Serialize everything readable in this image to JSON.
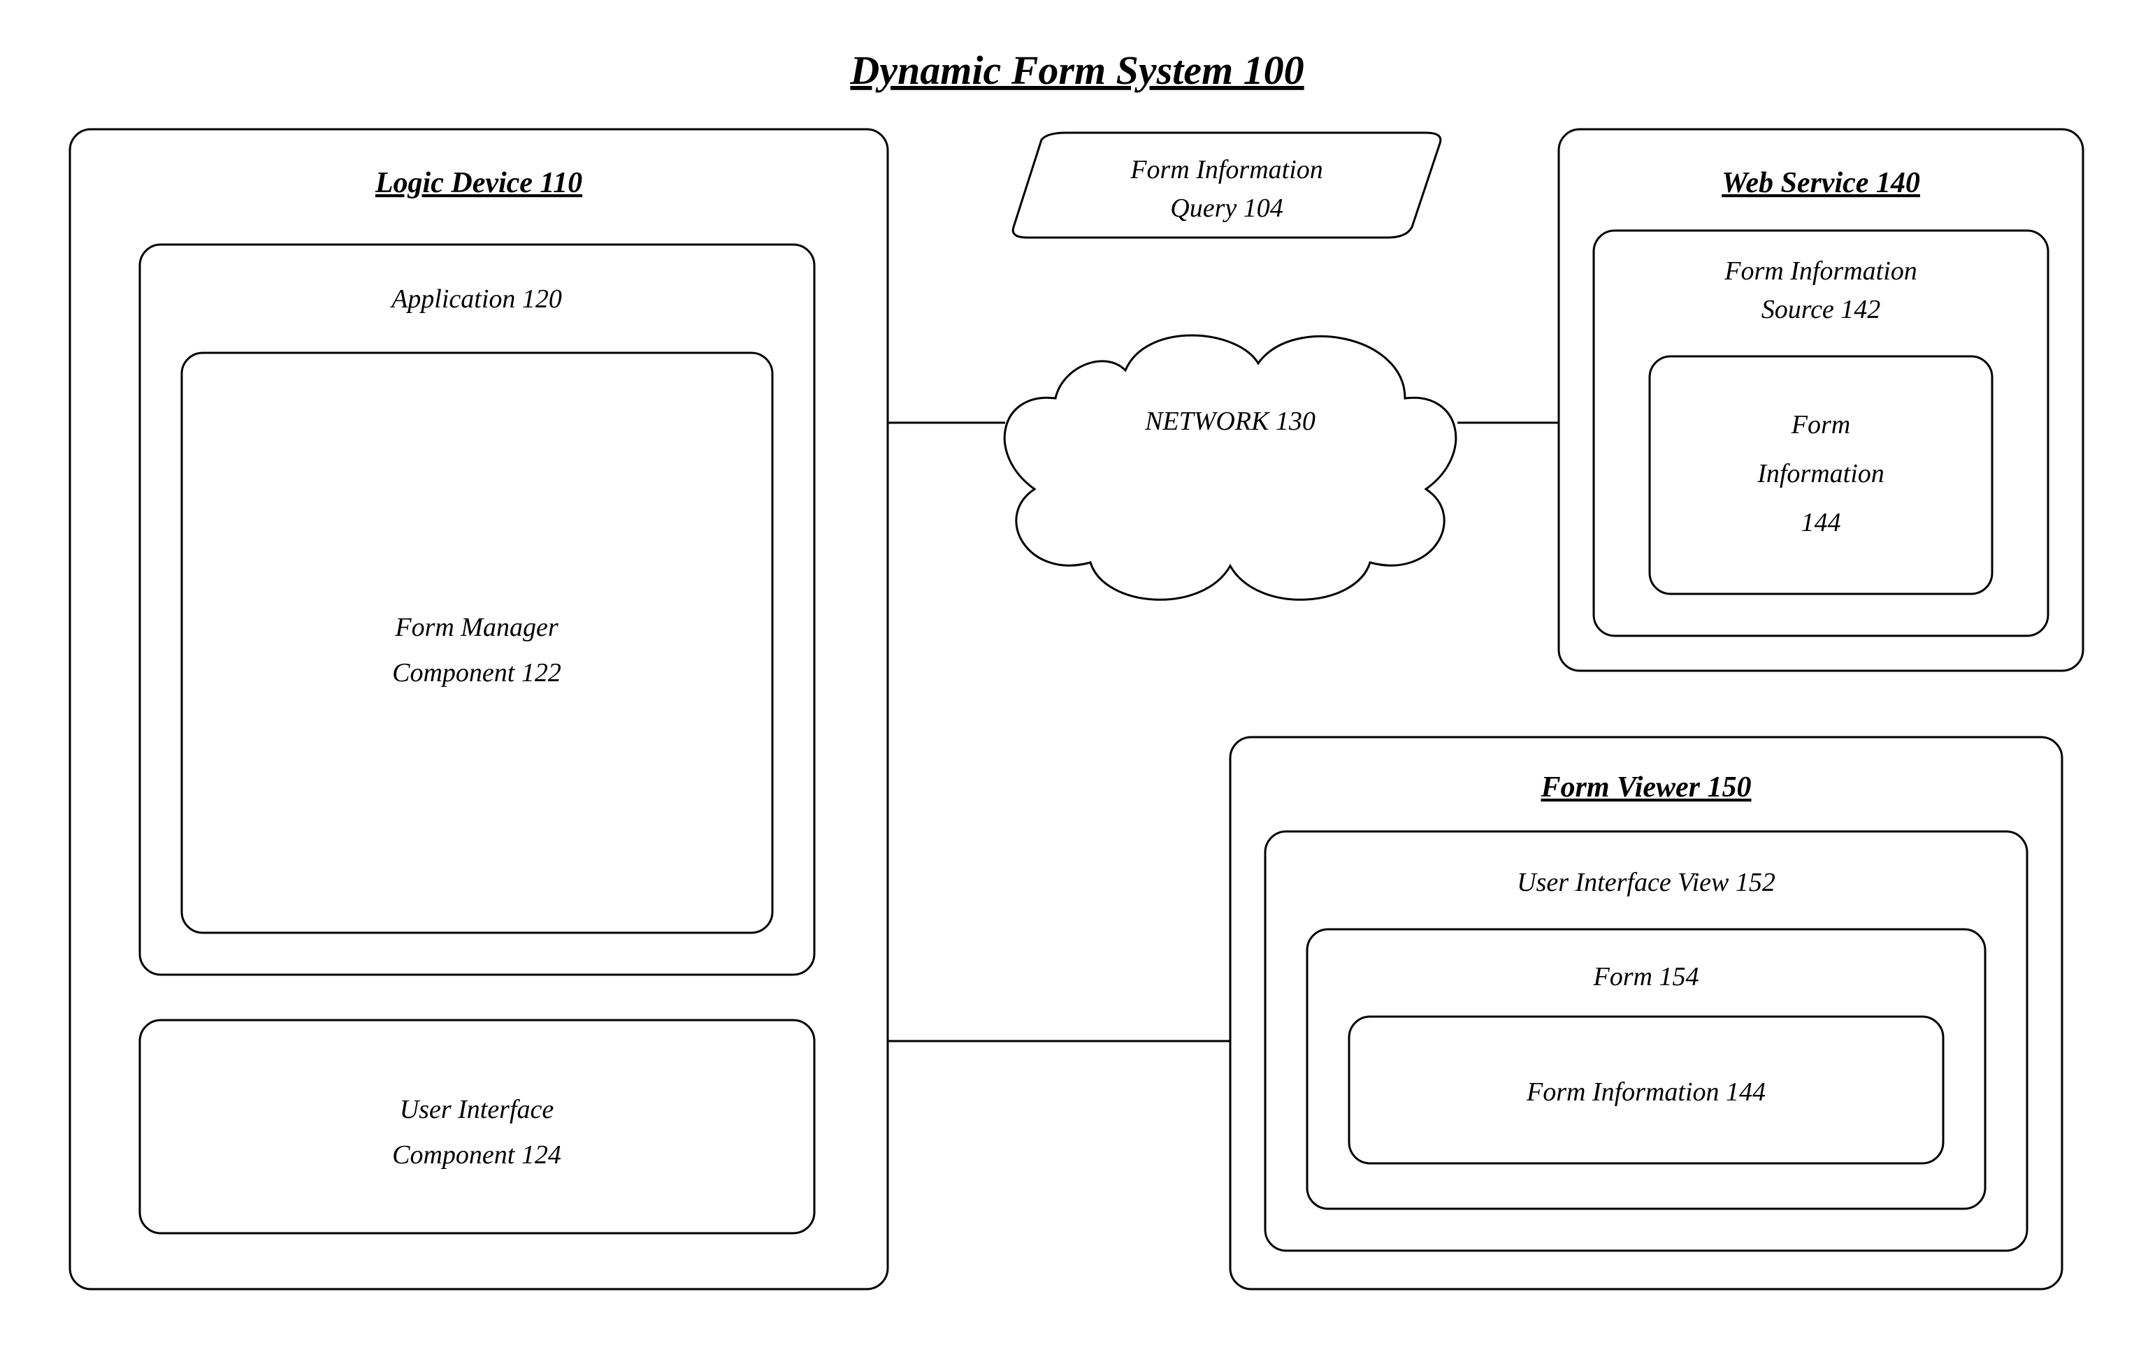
{
  "title": "Dynamic Form System 100",
  "logicDevice": {
    "title": "Logic Device 110",
    "application": {
      "title": "Application 120",
      "formManager": {
        "line1": "Form Manager",
        "line2": "Component 122"
      },
      "uiComponent": {
        "line1": "User Interface",
        "line2": "Component 124"
      }
    }
  },
  "network": {
    "query": {
      "line1": "Form Information",
      "line2": "Query 104"
    },
    "label": "NETWORK 130"
  },
  "webService": {
    "title": "Web Service 140",
    "source": {
      "line1": "Form Information",
      "line2": "Source 142"
    },
    "info": {
      "line1": "Form",
      "line2": "Information",
      "line3": "144"
    }
  },
  "formViewer": {
    "title": "Form Viewer 150",
    "uiView": "User Interface View 152",
    "form": "Form 154",
    "info": "Form Information 144"
  }
}
